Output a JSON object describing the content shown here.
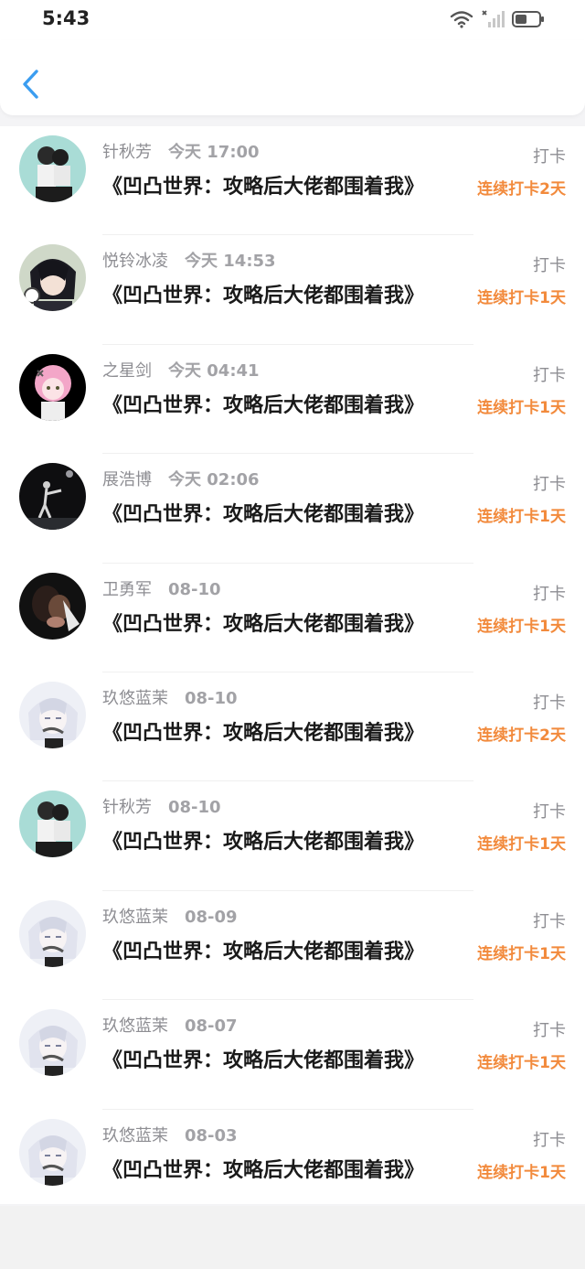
{
  "status": {
    "time": "5:43"
  },
  "nav": {
    "back_icon": "chevron-left-icon",
    "accent": "#3b9df0"
  },
  "colors": {
    "streak": "#f28a3c"
  },
  "items": [
    {
      "name": "针秋芳",
      "date": "今天 17:00",
      "book": "《凹凸世界：攻略后大佬都围着我》",
      "action": "打卡",
      "streak": "连续打卡2天",
      "avatar": "couple-photo"
    },
    {
      "name": "悦铃冰凌",
      "date": "今天 14:53",
      "book": "《凹凸世界：攻略后大佬都围着我》",
      "action": "打卡",
      "streak": "连续打卡1天",
      "avatar": "anime-dark-hair"
    },
    {
      "name": "之星剑",
      "date": "今天 04:41",
      "book": "《凹凸世界：攻略后大佬都围着我》",
      "action": "打卡",
      "streak": "连续打卡1天",
      "avatar": "anime-pink-hair"
    },
    {
      "name": "展浩博",
      "date": "今天 02:06",
      "book": "《凹凸世界：攻略后大佬都围着我》",
      "action": "打卡",
      "streak": "连续打卡1天",
      "avatar": "night-dancer"
    },
    {
      "name": "卫勇军",
      "date": "08-10",
      "book": "《凹凸世界：攻略后大佬都围着我》",
      "action": "打卡",
      "streak": "连续打卡1天",
      "avatar": "dark-figure"
    },
    {
      "name": "玖悠蓝茉",
      "date": "08-10",
      "book": "《凹凸世界：攻略后大佬都围着我》",
      "action": "打卡",
      "streak": "连续打卡2天",
      "avatar": "anime-white-hair"
    },
    {
      "name": "针秋芳",
      "date": "08-10",
      "book": "《凹凸世界：攻略后大佬都围着我》",
      "action": "打卡",
      "streak": "连续打卡1天",
      "avatar": "couple-photo"
    },
    {
      "name": "玖悠蓝茉",
      "date": "08-09",
      "book": "《凹凸世界：攻略后大佬都围着我》",
      "action": "打卡",
      "streak": "连续打卡1天",
      "avatar": "anime-white-hair"
    },
    {
      "name": "玖悠蓝茉",
      "date": "08-07",
      "book": "《凹凸世界：攻略后大佬都围着我》",
      "action": "打卡",
      "streak": "连续打卡1天",
      "avatar": "anime-white-hair"
    },
    {
      "name": "玖悠蓝茉",
      "date": "08-03",
      "book": "《凹凸世界：攻略后大佬都围着我》",
      "action": "打卡",
      "streak": "连续打卡1天",
      "avatar": "anime-white-hair"
    }
  ]
}
